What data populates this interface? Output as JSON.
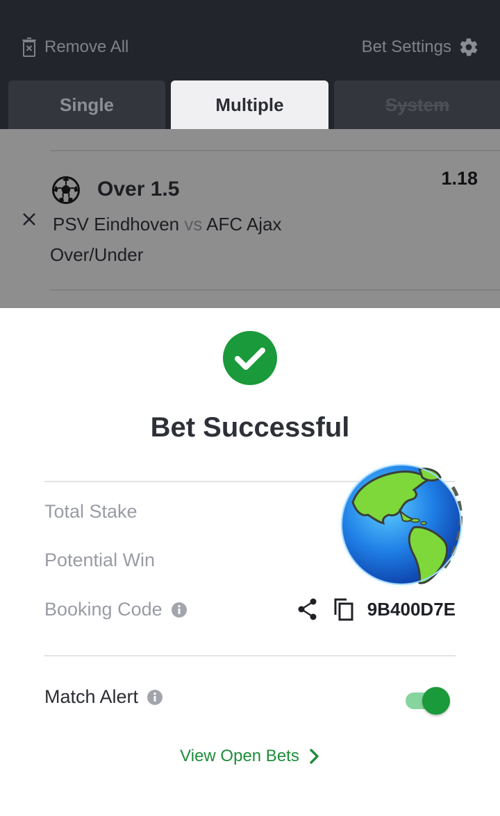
{
  "header": {
    "remove_all_label": "Remove All",
    "bet_settings_label": "Bet Settings"
  },
  "tabs": [
    {
      "label": "Single",
      "state": "inactive"
    },
    {
      "label": "Multiple",
      "state": "selected"
    },
    {
      "label": "System",
      "state": "disabled"
    }
  ],
  "bet": {
    "selection": "Over 1.5",
    "odds": "1.18",
    "home_team": "PSV Eindhoven",
    "vs": "vs",
    "away_team": "AFC Ajax",
    "market": "Over/Under",
    "sport_icon": "soccer-ball-icon"
  },
  "success": {
    "title": "Bet Successful",
    "total_stake_label": "Total Stake",
    "potential_win_label": "Potential Win",
    "booking_code_label": "Booking Code",
    "booking_code": "9B400D7E",
    "match_alert_label": "Match Alert",
    "match_alert_on": true,
    "view_open_bets_label": "View Open Bets"
  },
  "colors": {
    "header_bg": "#23252c",
    "accent_green": "#1a9a3a",
    "link_green": "#1f8c3a",
    "muted_text": "#9a9ca5"
  }
}
